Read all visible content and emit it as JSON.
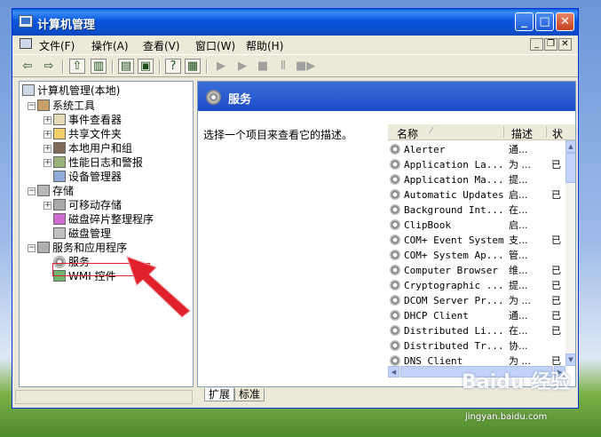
{
  "window": {
    "title": "计算机管理"
  },
  "menu": [
    "文件(F)",
    "操作(A)",
    "查看(V)",
    "窗口(W)",
    "帮助(H)"
  ],
  "tree": {
    "root": "计算机管理(本地)",
    "groups": [
      {
        "label": "系统工具",
        "items": [
          "事件查看器",
          "共享文件夹",
          "本地用户和组",
          "性能日志和警报",
          "设备管理器"
        ]
      },
      {
        "label": "存储",
        "items": [
          "可移动存储",
          "磁盘碎片整理程序",
          "磁盘管理"
        ]
      },
      {
        "label": "服务和应用程序",
        "items": [
          "服务",
          "WMI 控件"
        ]
      }
    ]
  },
  "right": {
    "title": "服务",
    "description": "选择一个项目来查看它的描述。",
    "columns": [
      "名称",
      "描述",
      "状"
    ],
    "rows": [
      {
        "name": "Alerter",
        "desc": "通...",
        "status": ""
      },
      {
        "name": "Application La...",
        "desc": "为 ...",
        "status": "已"
      },
      {
        "name": "Application Ma...",
        "desc": "提...",
        "status": ""
      },
      {
        "name": "Automatic Updates",
        "desc": "启...",
        "status": "已"
      },
      {
        "name": "Background Int...",
        "desc": "在...",
        "status": ""
      },
      {
        "name": "ClipBook",
        "desc": "启...",
        "status": ""
      },
      {
        "name": "COM+ Event System",
        "desc": "支...",
        "status": "已"
      },
      {
        "name": "COM+ System Ap...",
        "desc": "管...",
        "status": ""
      },
      {
        "name": "Computer Browser",
        "desc": "维...",
        "status": "已"
      },
      {
        "name": "Cryptographic ...",
        "desc": "提...",
        "status": "已"
      },
      {
        "name": "DCOM Server Pr...",
        "desc": "为 ...",
        "status": "已"
      },
      {
        "name": "DHCP Client",
        "desc": "通...",
        "status": "已"
      },
      {
        "name": "Distributed Li...",
        "desc": "在...",
        "status": "已"
      },
      {
        "name": "Distributed Tr...",
        "desc": "协...",
        "status": ""
      },
      {
        "name": "DNS Client",
        "desc": "为 ...",
        "status": "已"
      }
    ]
  },
  "tabs": [
    "扩展",
    "标准"
  ],
  "watermark": {
    "brand": "Baidu 经验",
    "url": "jingyan.baidu.com"
  },
  "colors": {
    "title_bar": "#0a54d8",
    "panel_header": "#2a5bd0",
    "annotation": "#e0202a"
  }
}
